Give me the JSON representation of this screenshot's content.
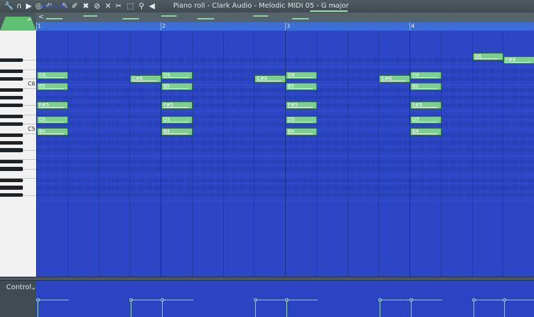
{
  "toolbar": {
    "title": "Piano roll - Clark Audio - Melodic MIDI 05 - G major",
    "caret": "▸",
    "icons": [
      {
        "name": "wrench-icon",
        "glyph": "🔧"
      },
      {
        "name": "magnet-icon",
        "glyph": "∩"
      },
      {
        "name": "play-icon",
        "glyph": "▶"
      },
      {
        "name": "record-icon",
        "glyph": "◎"
      },
      {
        "name": "undo-icon",
        "glyph": "↶"
      },
      {
        "name": "pencil-icon",
        "glyph": "✎"
      },
      {
        "name": "paint-brush-icon",
        "glyph": "✐"
      },
      {
        "name": "erase-icon",
        "glyph": "✖"
      },
      {
        "name": "delete-icon",
        "glyph": "⊘"
      },
      {
        "name": "mute-icon",
        "glyph": "✕"
      },
      {
        "name": "slice-icon",
        "glyph": "✂"
      },
      {
        "name": "select-icon",
        "glyph": "⬚"
      },
      {
        "name": "zoom-icon",
        "glyph": "⚲"
      },
      {
        "name": "speaker-icon",
        "glyph": "◀"
      }
    ]
  },
  "overview_nav": "<",
  "ruler": {
    "bars": [
      "1",
      "2",
      "3",
      "4"
    ]
  },
  "piano": {
    "labels": [
      "C6",
      "C5"
    ]
  },
  "notes": [
    {
      "name": "D6",
      "bar": 1
    },
    {
      "name": "B5",
      "bar": 1
    },
    {
      "name": "F#5",
      "bar": 1
    },
    {
      "name": "D5",
      "bar": 1
    },
    {
      "name": "B4",
      "bar": 1
    },
    {
      "name": "C#6",
      "bar": 1.75
    },
    {
      "name": "D6",
      "bar": 2
    },
    {
      "name": "B5",
      "bar": 2
    },
    {
      "name": "F#5",
      "bar": 2
    },
    {
      "name": "D5",
      "bar": 2
    },
    {
      "name": "B4",
      "bar": 2
    },
    {
      "name": "C#6",
      "bar": 2.75
    },
    {
      "name": "D6",
      "bar": 3
    },
    {
      "name": "B5",
      "bar": 3
    },
    {
      "name": "F#5",
      "bar": 3
    },
    {
      "name": "D5",
      "bar": 3
    },
    {
      "name": "B4",
      "bar": 3
    },
    {
      "name": "C#6",
      "bar": 3.75
    },
    {
      "name": "D6",
      "bar": 4
    },
    {
      "name": "B5",
      "bar": 4
    },
    {
      "name": "F#5",
      "bar": 4
    },
    {
      "name": "D5",
      "bar": 4
    },
    {
      "name": "B4",
      "bar": 4
    },
    {
      "name": "G6",
      "bar": 4.5
    },
    {
      "name": "F#6",
      "bar": 4.75
    }
  ],
  "control": {
    "label": "Control",
    "caret": "▸",
    "target": "Velocity"
  },
  "colors": {
    "grid": "#2d46c6",
    "note": "#7ccf8c",
    "ruler": "#3a6fd8"
  }
}
